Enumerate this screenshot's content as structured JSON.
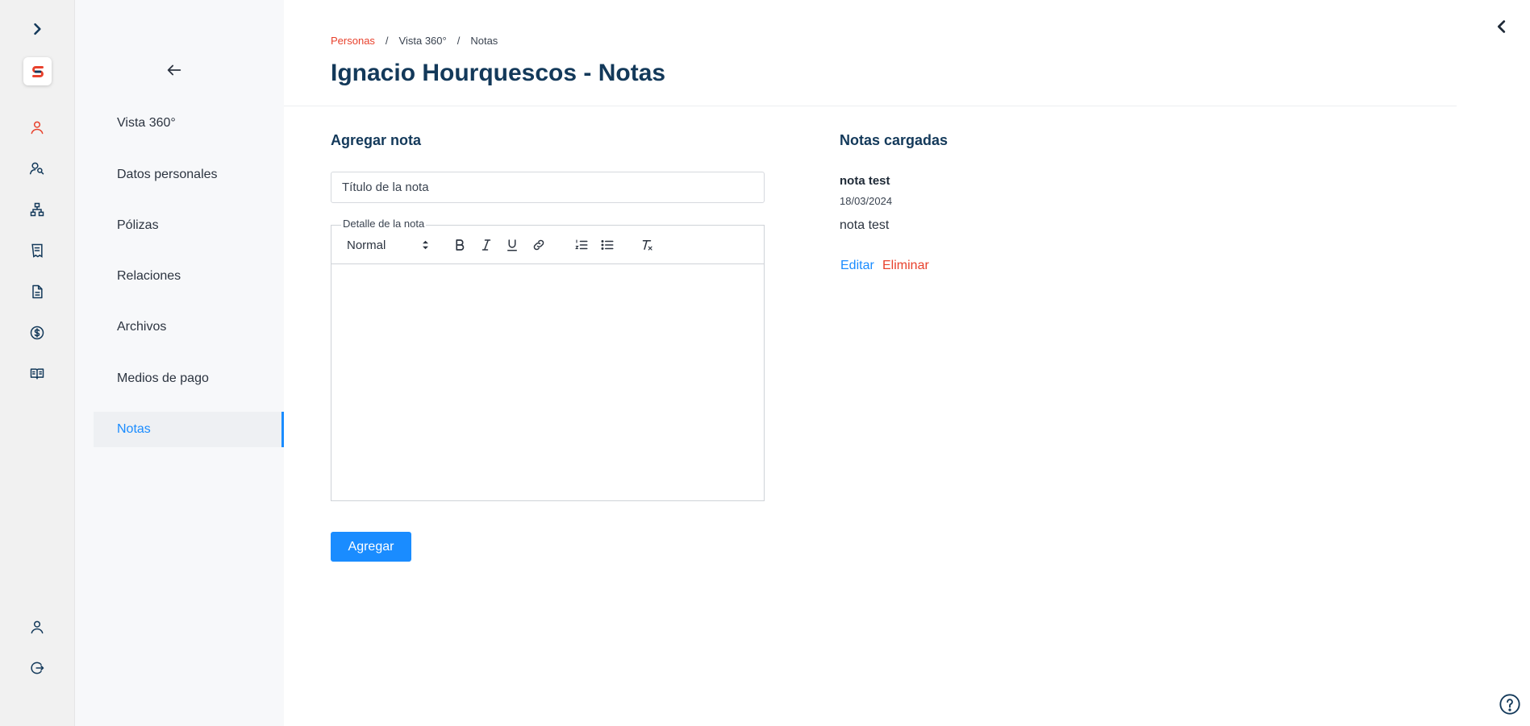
{
  "rail": {
    "icons": [
      "expand-chevron-icon",
      "app-logo",
      "person-icon",
      "people-search-icon",
      "hierarchy-icon",
      "receipt-icon",
      "document-icon",
      "dollar-icon",
      "book-icon",
      "account-icon",
      "logout-icon"
    ],
    "accent_color": "#e8412c",
    "icon_color": "#13395a"
  },
  "subnav": {
    "back_icon": "arrow-left-icon",
    "items": [
      {
        "label": "Vista 360°"
      },
      {
        "label": "Datos personales"
      },
      {
        "label": "Pólizas"
      },
      {
        "label": "Relaciones"
      },
      {
        "label": "Archivos"
      },
      {
        "label": "Medios de pago"
      },
      {
        "label": "Notas",
        "active": true
      }
    ]
  },
  "breadcrumb": {
    "items": [
      "Personas",
      "Vista 360°",
      "Notas"
    ],
    "separator": "/"
  },
  "page": {
    "title": "Ignacio Hourquescos - Notas"
  },
  "add_note": {
    "heading": "Agregar nota",
    "title_placeholder": "Título de la nota",
    "detail_legend": "Detalle de la nota",
    "header_select_value": "Normal",
    "toolbar_icons": [
      "bold-icon",
      "italic-icon",
      "underline-icon",
      "link-icon",
      "ordered-list-icon",
      "bullet-list-icon",
      "clear-format-icon"
    ],
    "submit_label": "Agregar"
  },
  "loaded_notes": {
    "heading": "Notas cargadas",
    "notes": [
      {
        "title": "nota test",
        "date": "18/03/2024",
        "body": "nota test",
        "edit_label": "Editar",
        "delete_label": "Eliminar"
      }
    ]
  },
  "colors": {
    "primary": "#1a8cff",
    "danger": "#e8412c",
    "heading": "#13395a"
  }
}
